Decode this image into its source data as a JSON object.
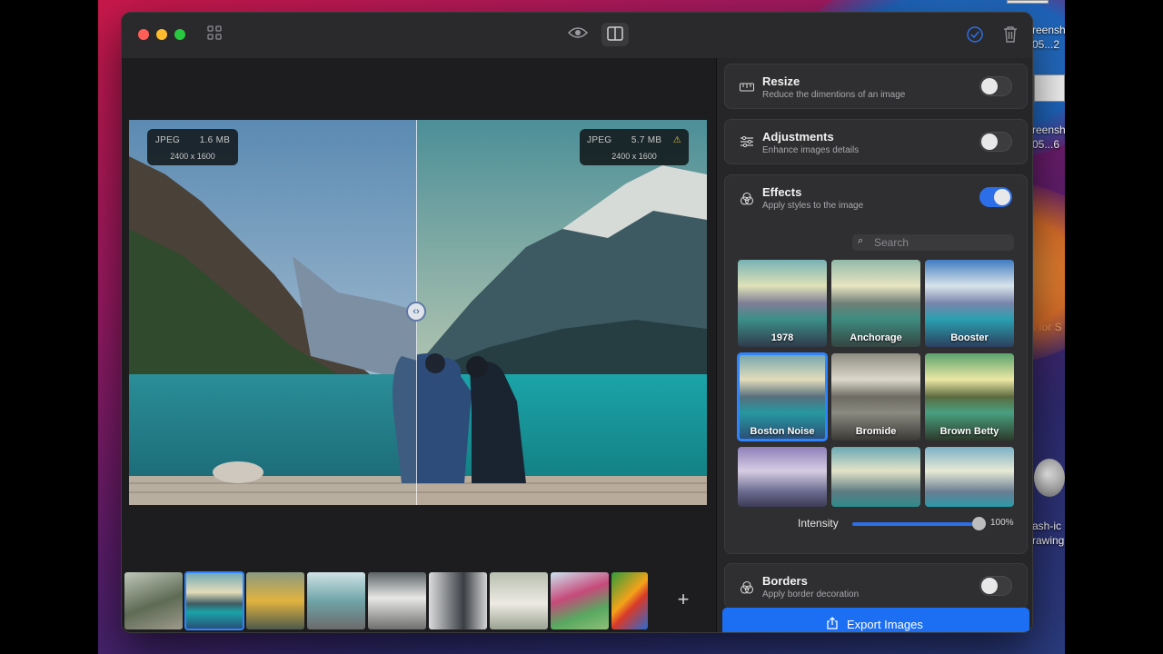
{
  "desktop": {
    "labels": [
      "reensh",
      "05...2",
      "reensh",
      "05...6",
      "s for S",
      "ash-ic",
      "rawing"
    ]
  },
  "titlebar": {
    "icons": [
      "grid-icon",
      "eye-icon",
      "split-view-icon",
      "checkmark-circle-icon",
      "trash-icon"
    ]
  },
  "preview": {
    "left_badge": {
      "format": "JPEG",
      "size": "1.6 MB",
      "dimensions": "2400 x 1600"
    },
    "right_badge": {
      "format": "JPEG",
      "size": "5.7 MB",
      "dimensions": "2400 x 1600",
      "warning_icon": "warning-icon"
    }
  },
  "filmstrip": {
    "count": 9,
    "selected_index": 1,
    "add_label": "+"
  },
  "panel": {
    "resize": {
      "title": "Resize",
      "subtitle": "Reduce the dimentions of an image",
      "enabled": false
    },
    "adjustments": {
      "title": "Adjustments",
      "subtitle": "Enhance images details",
      "enabled": false
    },
    "effects": {
      "title": "Effects",
      "subtitle": "Apply styles to the image",
      "enabled": true,
      "search_placeholder": "Search",
      "items": [
        "1978",
        "Anchorage",
        "Booster",
        "Boston Noise",
        "Bromide",
        "Brown Betty",
        "",
        "",
        ""
      ],
      "selected": "Boston Noise",
      "intensity_label": "Intensity",
      "intensity_value": "100%",
      "intensity_fraction": 1.0
    },
    "borders": {
      "title": "Borders",
      "subtitle": "Apply border decoration",
      "enabled": false
    },
    "export_label": "Export Images"
  },
  "colors": {
    "accent": "#1c6ff2",
    "toggle_on": "#2c6ee8"
  }
}
